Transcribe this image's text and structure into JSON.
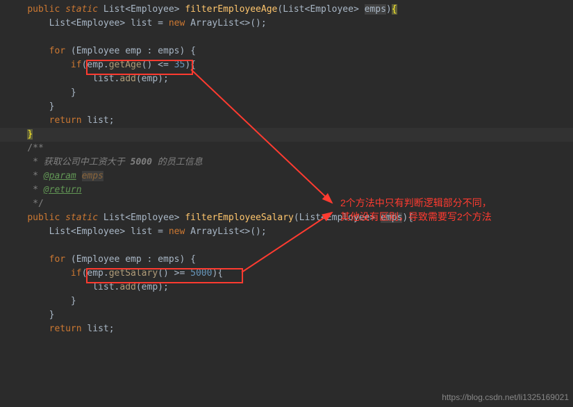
{
  "code": {
    "l1_kw1": "public",
    "l1_kw2": "static",
    "l1_type1": " List<Employee> ",
    "l1_method": "filterEmployeeAge",
    "l1_params": "(List<Employee> ",
    "l1_pvar": "emps",
    "l1_close": ")",
    "l1_brace": "{",
    "l2": "        List<Employee> list = ",
    "l2_kw": "new",
    "l2_rest": " ArrayList<>();",
    "l4_kw": "for",
    "l4_rest": " (Employee emp : emps) {",
    "l5_kw": "if",
    "l5_open": "(",
    "l5_expr1": "emp.",
    "l5_call": "getAge",
    "l5_op": "() <= ",
    "l5_num": "35",
    "l5_close": "){",
    "l6_pre": "                list.",
    "l6_call": "add",
    "l6_arg": "(emp);",
    "l7": "            }",
    "l8": "        }",
    "l9_kw": "return",
    "l9_rest": " list;",
    "l10": "    ",
    "l10_brace": "}",
    "c1": "    /**",
    "c2_star": "     * ",
    "c2_text": "获取公司中工资大于 ",
    "c2_num": "5000",
    "c2_text2": " 的员工信息",
    "c3_star": "     * ",
    "c3_tag": "@param",
    "c3_sp": " ",
    "c3_var": "emps",
    "c4_star": "     * ",
    "c4_tag": "@return",
    "c5": "     */",
    "m1_kw1": "public",
    "m1_kw2": "static",
    "m1_type1": " List<Employee> ",
    "m1_method": "filterEmployeeSalary",
    "m1_params": "(List<Employee> ",
    "m1_pvar": "emps",
    "m1_close": "){",
    "m2": "        List<Employee> list = ",
    "m2_kw": "new",
    "m2_rest": " ArrayList<>();",
    "m4_kw": "for",
    "m4_rest": " (Employee emp : emps) {",
    "m5_kw": "if",
    "m5_open": "(",
    "m5_expr1": "emp.",
    "m5_call": "getSalary",
    "m5_op": "() >= ",
    "m5_num": "5000",
    "m5_close": "){",
    "m6_pre": "                list.",
    "m6_call": "add",
    "m6_arg": "(emp);",
    "m7": "            }",
    "m8": "        }",
    "m9_kw": "return",
    "m9_rest": " list;"
  },
  "annotation": {
    "line1": "2个方法中只有判断逻辑部分不同，",
    "line2": "其他没有区别，导致需要写2个方法"
  },
  "watermark": "https://blog.csdn.net/li1325169021"
}
